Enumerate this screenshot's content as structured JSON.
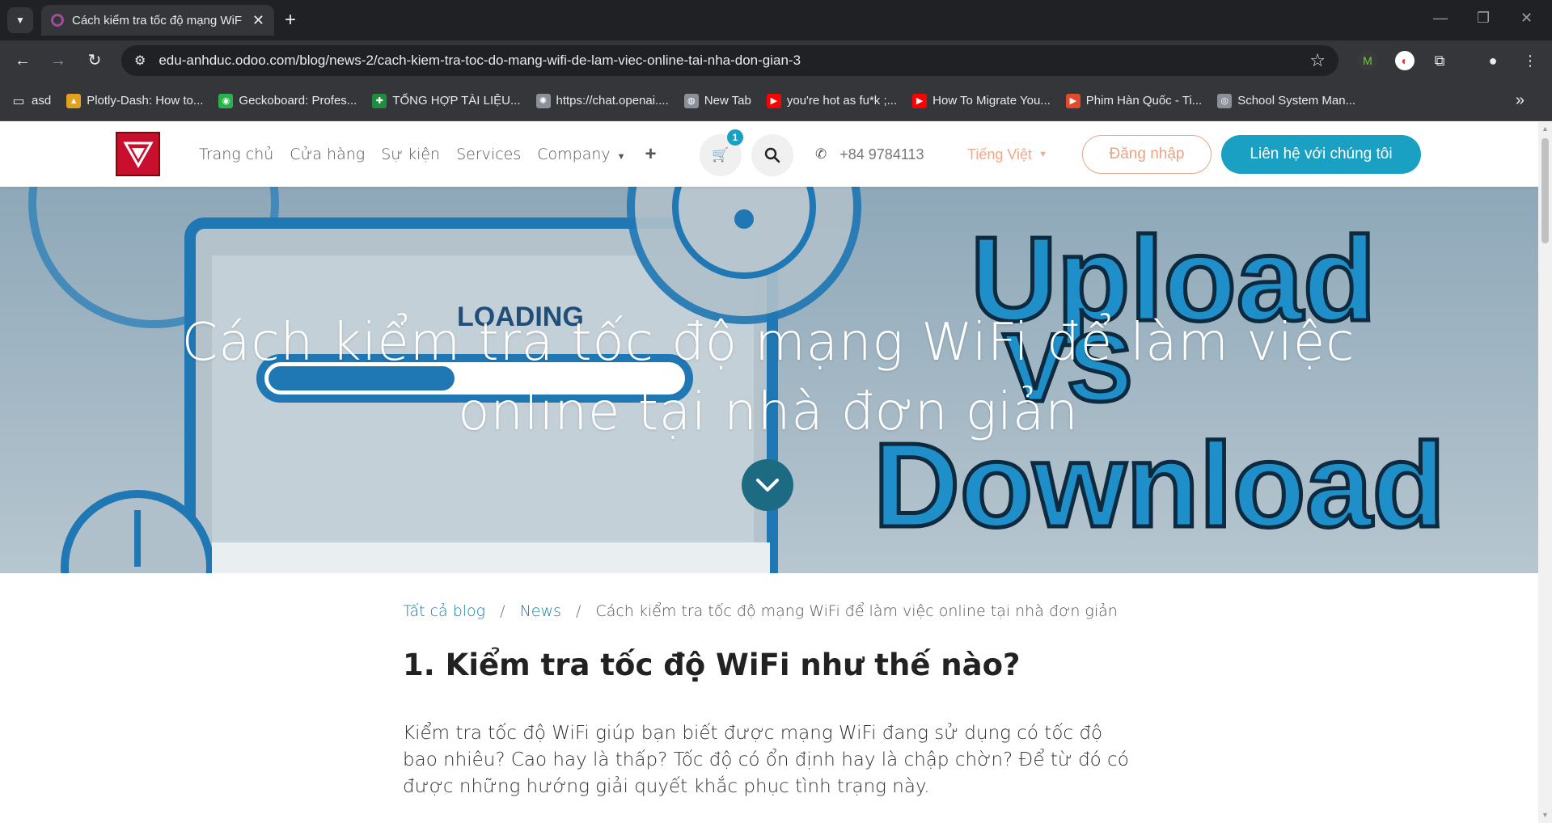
{
  "browser": {
    "tab_title": "Cách kiểm tra tốc độ mạng WiF",
    "url": "edu-anhduc.odoo.com/blog/news-2/cach-kiem-tra-toc-do-mang-wifi-de-lam-viec-online-tai-nha-don-gian-3",
    "bookmarks": [
      {
        "label": "asd",
        "icon": "folder-icon",
        "color": "#e8eaed"
      },
      {
        "label": "Plotly-Dash: How to...",
        "icon": "plotly-icon",
        "color": "#e0a020"
      },
      {
        "label": "Geckoboard: Profes...",
        "icon": "geckoboard-icon",
        "color": "#2bb24c"
      },
      {
        "label": "TỔNG HỢP TÀI LIỆU...",
        "icon": "sheets-icon",
        "color": "#1e8e3e"
      },
      {
        "label": "https://chat.openai....",
        "icon": "openai-icon",
        "color": "#8a8f98"
      },
      {
        "label": "New Tab",
        "icon": "globe-icon",
        "color": "#8a8f98"
      },
      {
        "label": "you're hot as fu*k ;...",
        "icon": "youtube-icon",
        "color": "#ff0000"
      },
      {
        "label": "How To Migrate You...",
        "icon": "youtube-icon",
        "color": "#ff0000"
      },
      {
        "label": "Phim Hàn Quốc - Ti...",
        "icon": "video-icon",
        "color": "#e24a2b"
      },
      {
        "label": "School System Man...",
        "icon": "school-icon",
        "color": "#8a8f98"
      }
    ]
  },
  "site": {
    "menu": [
      "Trang chủ",
      "Cửa hàng",
      "Sự kiện",
      "Services",
      "Company"
    ],
    "cart_count": "1",
    "phone": "+84 9784113",
    "language": "Tiếng Việt",
    "login": "Đăng nhập",
    "contact": "Liên hệ với chúng tôi",
    "accent_color": "#1aa0c2"
  },
  "hero": {
    "title": "Cách kiểm tra tốc độ mạng WiFi để làm việc online tại nhà đơn giản",
    "image_texts": {
      "loading": "LOADING",
      "upload": "Upload",
      "vs": "VS",
      "download": "Download"
    }
  },
  "breadcrumb": {
    "all_blogs": "Tất cả blog",
    "news": "News",
    "current": "Cách kiểm tra tốc độ mạng WiFi để làm việc online tại nhà đơn giản"
  },
  "article": {
    "heading": "1. Kiểm tra tốc độ WiFi như thế nào?",
    "paragraph": "Kiểm tra tốc độ WiFi giúp bạn biết được mạng WiFi đang sử dụng có tốc độ bao nhiêu? Cao hay là thấp? Tốc độ có ổn định hay là chập chờn? Để từ đó có được những hướng giải quyết khắc phục tình trạng này."
  }
}
